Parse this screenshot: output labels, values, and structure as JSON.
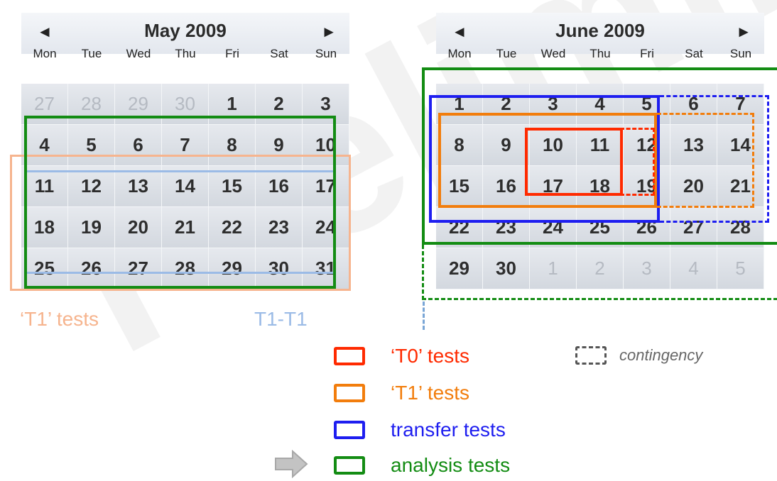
{
  "colors": {
    "t0": "#ff2a00",
    "t1": "#f27d0c",
    "transfer": "#1e1ef0",
    "analysis": "#138c13",
    "t1_faded": "#f6b48e",
    "t1t1_faded": "#9bbbe6",
    "contingency": "#555555"
  },
  "watermark": "Preliminary",
  "calendars": [
    {
      "title": "May 2009",
      "prev_icon": "◄",
      "next_icon": "►",
      "weekdays": [
        "Mon",
        "Tue",
        "Wed",
        "Thu",
        "Fri",
        "Sat",
        "Sun"
      ],
      "weeks": [
        [
          "27",
          "28",
          "29",
          "30",
          "1",
          "2",
          "3"
        ],
        [
          "4",
          "5",
          "6",
          "7",
          "8",
          "9",
          "10"
        ],
        [
          "11",
          "12",
          "13",
          "14",
          "15",
          "16",
          "17"
        ],
        [
          "18",
          "19",
          "20",
          "21",
          "22",
          "23",
          "24"
        ],
        [
          "25",
          "26",
          "27",
          "28",
          "29",
          "30",
          "31"
        ]
      ]
    },
    {
      "title": "June 2009",
      "prev_icon": "◄",
      "next_icon": "►",
      "weekdays": [
        "Mon",
        "Tue",
        "Wed",
        "Thu",
        "Fri",
        "Sat",
        "Sun"
      ],
      "weeks": [
        [
          "1",
          "2",
          "3",
          "4",
          "5",
          "6",
          "7"
        ],
        [
          "8",
          "9",
          "10",
          "11",
          "12",
          "13",
          "14"
        ],
        [
          "15",
          "16",
          "17",
          "18",
          "19",
          "20",
          "21"
        ],
        [
          "22",
          "23",
          "24",
          "25",
          "26",
          "27",
          "28"
        ],
        [
          "29",
          "30",
          "1",
          "2",
          "3",
          "4",
          "5"
        ]
      ]
    }
  ],
  "annotations": {
    "t1_tests": "‘T1’ tests",
    "t1_t1": "T1-T1"
  },
  "legend": [
    {
      "key": "t0",
      "label": "‘T0’ tests"
    },
    {
      "key": "t1",
      "label": "‘T1’ tests"
    },
    {
      "key": "transfer",
      "label": "transfer tests"
    },
    {
      "key": "analysis",
      "label": "analysis tests"
    }
  ],
  "contingency_label": "contingency"
}
